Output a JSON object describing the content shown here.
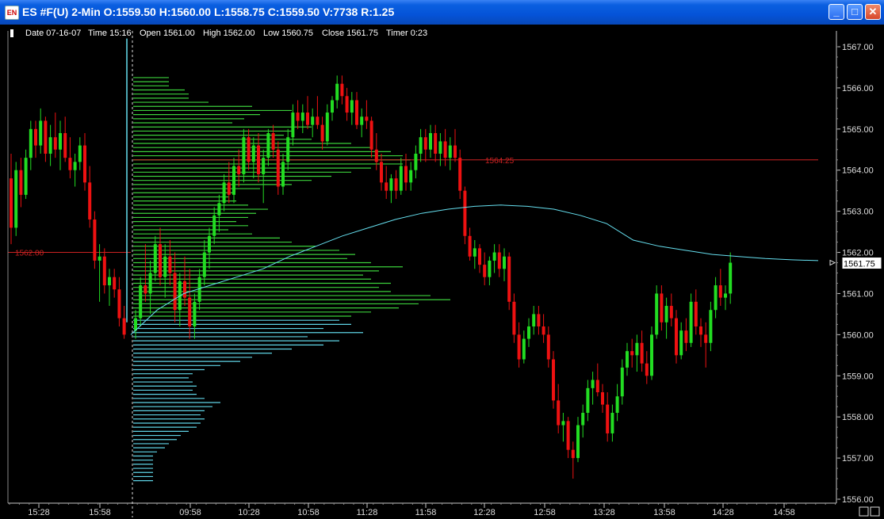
{
  "window": {
    "title": "ES #F(U) 2-Min O:1559.50 H:1560.00 L:1558.75 C:1559.50 V:7738 R:1.25",
    "icon_name": "chart-app-icon",
    "buttons": [
      "minimize-icon",
      "maximize-icon",
      "close-icon"
    ]
  },
  "info": {
    "date": "Date 07-16-07",
    "time": "Time 15:16",
    "open": "Open 1561.00",
    "high": "High 1562.00",
    "low": "Low 1560.75",
    "close": "Close 1561.75",
    "timer": "Timer 0:23"
  },
  "chart_data": {
    "type": "candlestick",
    "ylim": [
      1556.0,
      1567.0
    ],
    "y_ticks": [
      "1567.00",
      "1566.00",
      "1565.00",
      "1564.00",
      "1563.00",
      "1562.00",
      "1561.00",
      "1560.00",
      "1559.00",
      "1558.00",
      "1557.00",
      "1556.00"
    ],
    "x_ticks": [
      "15:28",
      "15:58",
      "09:58",
      "10:28",
      "10:58",
      "11:28",
      "11:58",
      "12:28",
      "12:58",
      "13:28",
      "13:58",
      "14:28",
      "14:58"
    ],
    "last_price": "1561.75",
    "hlines": [
      {
        "label": "1562.00",
        "value": 1562.0
      },
      {
        "label": "1564.25",
        "value": 1564.25
      }
    ],
    "colors": {
      "up": "#22dd22",
      "down": "#ee1111",
      "vwap": "#66e0f0",
      "profile_upper": "#3bcf3b",
      "profile_lower": "#5fd4e6",
      "level": "#cc2222",
      "axis": "#c8c8c8"
    },
    "candles_prev_session": [
      [
        1563.8,
        1564.4,
        1562.2,
        1562.6
      ],
      [
        1562.6,
        1564.2,
        1562.4,
        1564.0
      ],
      [
        1564.0,
        1564.3,
        1563.1,
        1563.4
      ],
      [
        1563.4,
        1564.5,
        1563.3,
        1564.3
      ],
      [
        1564.3,
        1565.2,
        1564.0,
        1565.0
      ],
      [
        1565.0,
        1565.2,
        1564.3,
        1564.6
      ],
      [
        1564.6,
        1565.5,
        1564.4,
        1565.2
      ],
      [
        1565.2,
        1565.3,
        1564.2,
        1564.4
      ],
      [
        1564.4,
        1565.1,
        1564.1,
        1564.8
      ],
      [
        1564.8,
        1565.4,
        1564.3,
        1564.5
      ],
      [
        1564.5,
        1565.2,
        1564.0,
        1564.9
      ],
      [
        1564.9,
        1565.3,
        1564.2,
        1564.3
      ],
      [
        1564.3,
        1564.8,
        1563.8,
        1564.0
      ],
      [
        1564.0,
        1564.4,
        1563.6,
        1564.2
      ],
      [
        1564.2,
        1564.8,
        1564.0,
        1564.6
      ],
      [
        1564.6,
        1564.9,
        1563.5,
        1563.7
      ],
      [
        1563.7,
        1564.1,
        1562.6,
        1562.8
      ],
      [
        1562.8,
        1563.0,
        1561.6,
        1561.8
      ],
      [
        1561.8,
        1562.2,
        1560.8,
        1561.9
      ],
      [
        1561.9,
        1562.1,
        1561.0,
        1561.2
      ],
      [
        1561.2,
        1561.6,
        1560.7,
        1561.4
      ],
      [
        1561.4,
        1561.6,
        1560.9,
        1561.1
      ],
      [
        1561.1,
        1561.4,
        1560.2,
        1560.4
      ],
      [
        1560.4,
        1560.7,
        1559.9,
        1560.0
      ]
    ],
    "candles_session": [
      [
        1560.1,
        1560.6,
        1559.9,
        1560.4
      ],
      [
        1560.4,
        1561.4,
        1560.2,
        1561.2
      ],
      [
        1561.2,
        1562.2,
        1560.8,
        1561.0
      ],
      [
        1561.0,
        1561.8,
        1560.5,
        1561.5
      ],
      [
        1561.5,
        1562.4,
        1561.3,
        1562.2
      ],
      [
        1562.2,
        1562.6,
        1561.2,
        1561.4
      ],
      [
        1561.4,
        1562.2,
        1560.9,
        1561.9
      ],
      [
        1561.9,
        1562.3,
        1561.2,
        1561.5
      ],
      [
        1561.5,
        1562.0,
        1560.3,
        1560.6
      ],
      [
        1560.6,
        1561.5,
        1560.2,
        1561.3
      ],
      [
        1561.3,
        1561.9,
        1560.7,
        1560.9
      ],
      [
        1560.9,
        1561.6,
        1559.9,
        1560.2
      ],
      [
        1560.2,
        1561.0,
        1559.9,
        1560.8
      ],
      [
        1560.8,
        1561.6,
        1560.6,
        1561.4
      ],
      [
        1561.4,
        1562.3,
        1561.2,
        1562.0
      ],
      [
        1562.0,
        1562.6,
        1561.6,
        1562.4
      ],
      [
        1562.4,
        1563.1,
        1562.2,
        1562.9
      ],
      [
        1562.9,
        1563.4,
        1562.5,
        1563.2
      ],
      [
        1563.2,
        1563.9,
        1563.0,
        1563.7
      ],
      [
        1563.7,
        1564.2,
        1563.2,
        1563.4
      ],
      [
        1563.4,
        1564.3,
        1563.2,
        1564.1
      ],
      [
        1564.1,
        1564.5,
        1563.6,
        1563.9
      ],
      [
        1563.9,
        1565.0,
        1563.7,
        1564.8
      ],
      [
        1564.8,
        1565.0,
        1564.0,
        1564.2
      ],
      [
        1564.2,
        1564.8,
        1563.8,
        1564.6
      ],
      [
        1564.6,
        1564.9,
        1563.7,
        1563.9
      ],
      [
        1563.9,
        1564.5,
        1563.2,
        1564.3
      ],
      [
        1564.3,
        1565.0,
        1564.1,
        1564.9
      ],
      [
        1564.9,
        1565.1,
        1564.3,
        1564.5
      ],
      [
        1564.5,
        1564.7,
        1563.4,
        1563.6
      ],
      [
        1563.6,
        1564.4,
        1563.4,
        1564.2
      ],
      [
        1564.2,
        1565.0,
        1564.0,
        1564.8
      ],
      [
        1564.8,
        1565.6,
        1564.6,
        1565.4
      ],
      [
        1565.4,
        1565.7,
        1565.0,
        1565.2
      ],
      [
        1565.2,
        1565.6,
        1564.9,
        1565.4
      ],
      [
        1565.4,
        1565.8,
        1565.0,
        1565.1
      ],
      [
        1565.1,
        1565.5,
        1564.8,
        1565.3
      ],
      [
        1565.3,
        1565.8,
        1565.0,
        1565.1
      ],
      [
        1565.1,
        1565.3,
        1564.5,
        1564.7
      ],
      [
        1564.7,
        1565.6,
        1564.6,
        1565.4
      ],
      [
        1565.4,
        1565.8,
        1565.2,
        1565.7
      ],
      [
        1565.7,
        1566.3,
        1565.5,
        1566.1
      ],
      [
        1566.1,
        1566.3,
        1565.6,
        1565.8
      ],
      [
        1565.8,
        1566.0,
        1565.2,
        1565.4
      ],
      [
        1565.4,
        1565.9,
        1565.1,
        1565.7
      ],
      [
        1565.7,
        1565.9,
        1565.0,
        1565.1
      ],
      [
        1565.1,
        1565.5,
        1564.8,
        1565.3
      ],
      [
        1565.3,
        1565.7,
        1565.0,
        1565.2
      ],
      [
        1565.2,
        1565.3,
        1564.3,
        1564.5
      ],
      [
        1564.5,
        1564.9,
        1564.0,
        1564.2
      ],
      [
        1564.2,
        1564.4,
        1563.5,
        1563.7
      ],
      [
        1563.7,
        1564.1,
        1563.3,
        1563.5
      ],
      [
        1563.5,
        1563.9,
        1563.2,
        1563.8
      ],
      [
        1563.8,
        1564.0,
        1563.3,
        1563.5
      ],
      [
        1563.5,
        1564.3,
        1563.4,
        1564.1
      ],
      [
        1564.1,
        1564.4,
        1563.5,
        1563.7
      ],
      [
        1563.7,
        1564.2,
        1563.5,
        1564.0
      ],
      [
        1564.0,
        1564.6,
        1563.8,
        1564.4
      ],
      [
        1564.4,
        1565.0,
        1564.2,
        1564.8
      ],
      [
        1564.8,
        1565.0,
        1564.2,
        1564.5
      ],
      [
        1564.5,
        1565.1,
        1564.3,
        1564.9
      ],
      [
        1564.9,
        1565.1,
        1564.2,
        1564.4
      ],
      [
        1564.4,
        1564.9,
        1564.1,
        1564.7
      ],
      [
        1564.7,
        1565.0,
        1564.1,
        1564.3
      ],
      [
        1564.3,
        1564.8,
        1564.0,
        1564.6
      ],
      [
        1564.6,
        1565.0,
        1564.2,
        1564.3
      ],
      [
        1564.3,
        1564.5,
        1563.3,
        1563.5
      ],
      [
        1563.5,
        1563.6,
        1562.2,
        1562.4
      ],
      [
        1562.4,
        1562.6,
        1561.8,
        1561.9
      ],
      [
        1561.9,
        1562.3,
        1561.6,
        1562.1
      ],
      [
        1562.1,
        1562.2,
        1561.5,
        1561.7
      ],
      [
        1561.7,
        1562.0,
        1561.2,
        1561.4
      ],
      [
        1561.4,
        1561.9,
        1561.2,
        1561.8
      ],
      [
        1561.8,
        1562.2,
        1561.5,
        1562.0
      ],
      [
        1562.0,
        1562.2,
        1561.4,
        1561.6
      ],
      [
        1561.6,
        1562.1,
        1561.3,
        1561.9
      ],
      [
        1561.9,
        1562.0,
        1560.6,
        1560.8
      ],
      [
        1560.8,
        1561.0,
        1559.8,
        1560.0
      ],
      [
        1560.0,
        1560.3,
        1559.2,
        1559.4
      ],
      [
        1559.4,
        1560.1,
        1559.3,
        1559.9
      ],
      [
        1559.9,
        1560.4,
        1559.7,
        1560.2
      ],
      [
        1560.2,
        1560.7,
        1560.0,
        1560.5
      ],
      [
        1560.5,
        1560.7,
        1560.0,
        1560.2
      ],
      [
        1560.2,
        1560.5,
        1559.8,
        1560.0
      ],
      [
        1560.0,
        1560.2,
        1559.2,
        1559.4
      ],
      [
        1559.4,
        1559.6,
        1558.2,
        1558.4
      ],
      [
        1558.4,
        1558.8,
        1557.6,
        1557.8
      ],
      [
        1557.8,
        1558.1,
        1557.4,
        1557.9
      ],
      [
        1557.9,
        1558.0,
        1557.0,
        1557.2
      ],
      [
        1557.2,
        1557.4,
        1556.5,
        1557.0
      ],
      [
        1557.0,
        1558.0,
        1556.9,
        1557.8
      ],
      [
        1557.8,
        1558.3,
        1557.5,
        1558.1
      ],
      [
        1558.1,
        1558.9,
        1557.9,
        1558.7
      ],
      [
        1558.7,
        1559.1,
        1558.3,
        1558.9
      ],
      [
        1558.9,
        1559.3,
        1558.5,
        1558.6
      ],
      [
        1558.6,
        1558.8,
        1558.1,
        1558.3
      ],
      [
        1558.3,
        1558.6,
        1557.4,
        1557.6
      ],
      [
        1557.6,
        1558.3,
        1557.4,
        1558.1
      ],
      [
        1558.1,
        1558.8,
        1557.9,
        1558.5
      ],
      [
        1558.5,
        1559.4,
        1558.3,
        1559.2
      ],
      [
        1559.2,
        1559.8,
        1559.0,
        1559.6
      ],
      [
        1559.6,
        1559.9,
        1559.2,
        1559.5
      ],
      [
        1559.5,
        1560.0,
        1559.1,
        1559.8
      ],
      [
        1559.8,
        1560.1,
        1559.1,
        1559.3
      ],
      [
        1559.3,
        1559.6,
        1558.8,
        1559.0
      ],
      [
        1559.0,
        1560.2,
        1558.9,
        1560.0
      ],
      [
        1560.0,
        1561.2,
        1559.9,
        1561.0
      ],
      [
        1561.0,
        1561.2,
        1560.1,
        1560.3
      ],
      [
        1560.3,
        1560.9,
        1559.9,
        1560.7
      ],
      [
        1560.7,
        1561.0,
        1560.2,
        1560.4
      ],
      [
        1560.4,
        1560.6,
        1559.3,
        1559.5
      ],
      [
        1559.5,
        1560.3,
        1559.4,
        1560.1
      ],
      [
        1560.1,
        1560.4,
        1559.6,
        1559.8
      ],
      [
        1559.8,
        1561.0,
        1559.7,
        1560.8
      ],
      [
        1560.8,
        1561.1,
        1560.0,
        1560.2
      ],
      [
        1560.2,
        1560.4,
        1559.7,
        1560.0
      ],
      [
        1560.0,
        1560.3,
        1559.2,
        1559.8
      ],
      [
        1559.8,
        1560.8,
        1559.6,
        1560.6
      ],
      [
        1560.6,
        1561.4,
        1560.4,
        1561.2
      ],
      [
        1561.2,
        1561.6,
        1560.7,
        1560.9
      ],
      [
        1560.9,
        1561.2,
        1560.6,
        1561.0
      ],
      [
        1561.0,
        1562.0,
        1560.75,
        1561.75
      ]
    ],
    "vwap": [
      1560.0,
      1560.6,
      1561.0,
      1561.2,
      1561.4,
      1561.6,
      1561.9,
      1562.15,
      1562.4,
      1562.6,
      1562.8,
      1562.95,
      1563.05,
      1563.12,
      1563.15,
      1563.12,
      1563.05,
      1562.9,
      1562.7,
      1562.3,
      1562.15,
      1562.05,
      1561.95,
      1561.9,
      1561.85,
      1561.82,
      1561.8
    ],
    "profile_upper": [
      [
        1566.25,
        9
      ],
      [
        1566.15,
        9
      ],
      [
        1566.05,
        9
      ],
      [
        1565.95,
        13
      ],
      [
        1565.85,
        14
      ],
      [
        1565.75,
        14
      ],
      [
        1565.65,
        19
      ],
      [
        1565.55,
        30
      ],
      [
        1565.45,
        40
      ],
      [
        1565.35,
        32
      ],
      [
        1565.25,
        28
      ],
      [
        1565.15,
        25
      ],
      [
        1565.05,
        45
      ],
      [
        1564.95,
        40
      ],
      [
        1564.85,
        38
      ],
      [
        1564.75,
        45
      ],
      [
        1564.65,
        55
      ],
      [
        1564.55,
        60
      ],
      [
        1564.45,
        65
      ],
      [
        1564.35,
        68
      ],
      [
        1564.25,
        70
      ],
      [
        1564.15,
        68
      ],
      [
        1564.05,
        60
      ],
      [
        1563.95,
        55
      ],
      [
        1563.85,
        50
      ],
      [
        1563.75,
        45
      ],
      [
        1563.65,
        40
      ],
      [
        1563.55,
        32
      ],
      [
        1563.45,
        25
      ],
      [
        1563.35,
        24
      ],
      [
        1563.25,
        26
      ],
      [
        1563.15,
        29
      ],
      [
        1563.05,
        34
      ],
      [
        1562.95,
        31
      ],
      [
        1562.85,
        29
      ],
      [
        1562.75,
        26
      ],
      [
        1562.65,
        29
      ],
      [
        1562.55,
        24
      ],
      [
        1562.45,
        30
      ],
      [
        1562.35,
        37
      ],
      [
        1562.25,
        40
      ],
      [
        1562.15,
        46
      ],
      [
        1562.05,
        52
      ],
      [
        1561.95,
        56
      ],
      [
        1561.85,
        54
      ],
      [
        1561.75,
        60
      ],
      [
        1561.65,
        68
      ],
      [
        1561.55,
        62
      ],
      [
        1561.45,
        58
      ],
      [
        1561.35,
        60
      ],
      [
        1561.25,
        65
      ],
      [
        1561.15,
        62
      ],
      [
        1561.05,
        65
      ],
      [
        1560.95,
        75
      ],
      [
        1560.85,
        80
      ],
      [
        1560.75,
        72
      ],
      [
        1560.65,
        67
      ],
      [
        1560.55,
        60
      ],
      [
        1560.45,
        55
      ]
    ],
    "profile_lower": [
      [
        1560.35,
        52
      ],
      [
        1560.25,
        55
      ],
      [
        1560.15,
        48
      ],
      [
        1560.05,
        58
      ],
      [
        1559.95,
        44
      ],
      [
        1559.85,
        52
      ],
      [
        1559.75,
        48
      ],
      [
        1559.65,
        40
      ],
      [
        1559.55,
        35
      ],
      [
        1559.45,
        30
      ],
      [
        1559.35,
        27
      ],
      [
        1559.25,
        22
      ],
      [
        1559.15,
        18
      ],
      [
        1559.05,
        15
      ],
      [
        1558.95,
        14
      ],
      [
        1558.85,
        15
      ],
      [
        1558.75,
        16
      ],
      [
        1558.65,
        15
      ],
      [
        1558.55,
        16
      ],
      [
        1558.45,
        18
      ],
      [
        1558.35,
        22
      ],
      [
        1558.25,
        20
      ],
      [
        1558.15,
        18
      ],
      [
        1558.05,
        17
      ],
      [
        1557.95,
        18
      ],
      [
        1557.85,
        17
      ],
      [
        1557.75,
        16
      ],
      [
        1557.65,
        14
      ],
      [
        1557.55,
        12
      ],
      [
        1557.45,
        11
      ],
      [
        1557.35,
        9
      ],
      [
        1557.25,
        8
      ],
      [
        1557.15,
        6
      ],
      [
        1557.05,
        5
      ],
      [
        1556.95,
        5
      ],
      [
        1556.85,
        5
      ],
      [
        1556.75,
        5
      ],
      [
        1556.65,
        5
      ],
      [
        1556.55,
        5
      ],
      [
        1556.45,
        5
      ]
    ]
  }
}
